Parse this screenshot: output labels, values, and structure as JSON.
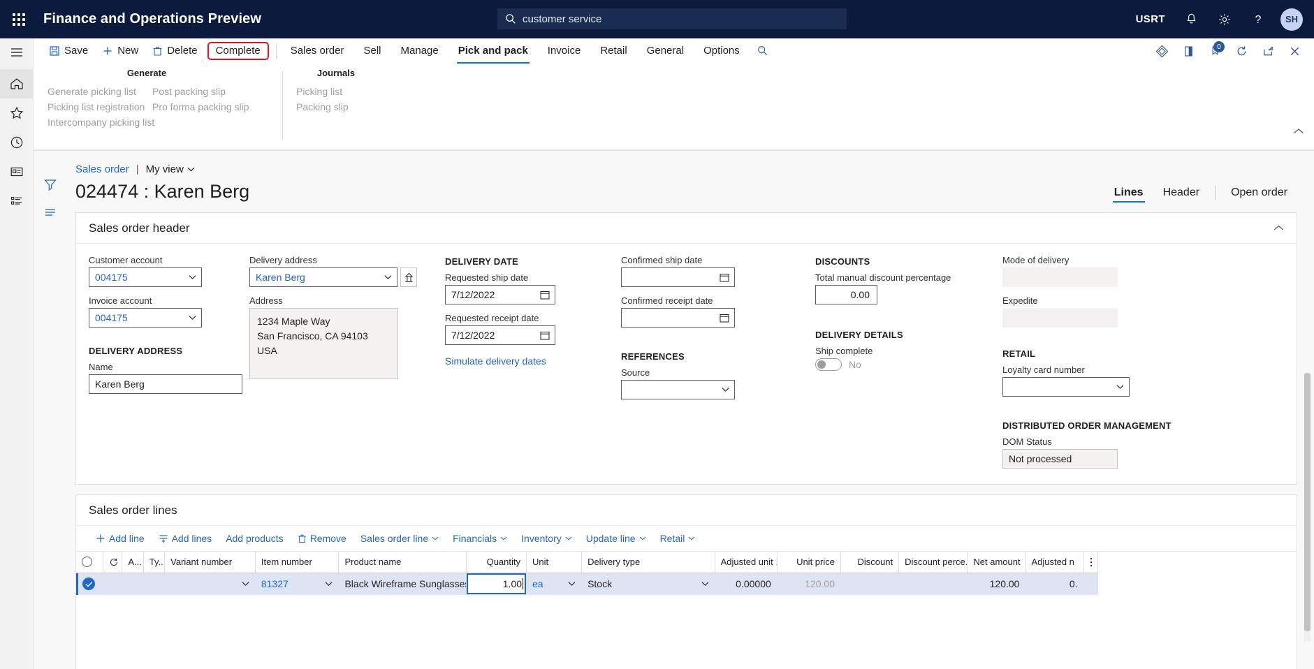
{
  "topbar": {
    "app_title": "Finance and Operations Preview",
    "search_value": "customer service",
    "company": "USRT",
    "avatar_initials": "SH",
    "icons": [
      "waffle-icon",
      "search-icon",
      "notification-bell-icon",
      "settings-gear-icon",
      "help-question-icon"
    ]
  },
  "ribbon": {
    "commands": [
      {
        "label": "Save",
        "icon": "save-icon"
      },
      {
        "label": "New",
        "icon": "plus-icon"
      },
      {
        "label": "Delete",
        "icon": "trash-icon"
      }
    ],
    "complete_label": "Complete",
    "tabs": [
      {
        "label": "Sales order",
        "active": false
      },
      {
        "label": "Sell",
        "active": false
      },
      {
        "label": "Manage",
        "active": false
      },
      {
        "label": "Pick and pack",
        "active": true
      },
      {
        "label": "Invoice",
        "active": false
      },
      {
        "label": "Retail",
        "active": false
      },
      {
        "label": "General",
        "active": false
      },
      {
        "label": "Options",
        "active": false
      }
    ],
    "search_icon": "search-icon",
    "right_icons": [
      "attachments-icon",
      "open-in-new-window-icon",
      "notes-icon",
      "refresh-icon",
      "popout-icon",
      "close-icon"
    ],
    "notes_badge": "0"
  },
  "ribbon_panel": {
    "groups": [
      {
        "title": "Generate",
        "columns": [
          [
            "Generate picking list",
            "Picking list registration",
            "Intercompany picking list"
          ],
          [
            "Post packing slip",
            "Pro forma packing slip"
          ]
        ]
      },
      {
        "title": "Journals",
        "columns": [
          [
            "Picking list",
            "Packing slip"
          ]
        ]
      }
    ]
  },
  "breadcrumb": {
    "root": "Sales order",
    "separator": "|",
    "view": "My view"
  },
  "page": {
    "title": "024474 : Karen Berg",
    "tabs": [
      {
        "label": "Lines",
        "active": true
      },
      {
        "label": "Header",
        "active": false
      },
      {
        "label": "Open order",
        "active": false
      }
    ]
  },
  "header_card": {
    "title": "Sales order header",
    "customer_account": {
      "label": "Customer account",
      "value": "004175"
    },
    "invoice_account": {
      "label": "Invoice account",
      "value": "004175"
    },
    "delivery_address_section": "DELIVERY ADDRESS",
    "name": {
      "label": "Name",
      "value": "Karen Berg"
    },
    "delivery_address": {
      "label": "Delivery address",
      "value": "Karen Berg"
    },
    "address": {
      "label": "Address",
      "value": "1234 Maple Way\nSan Francisco, CA 94103\nUSA"
    },
    "delivery_date_section": "DELIVERY DATE",
    "requested_ship_date": {
      "label": "Requested ship date",
      "value": "7/12/2022"
    },
    "requested_receipt_date": {
      "label": "Requested receipt date",
      "value": "7/12/2022"
    },
    "simulate_link": "Simulate delivery dates",
    "confirmed_ship_date": {
      "label": "Confirmed ship date",
      "value": ""
    },
    "confirmed_receipt_date": {
      "label": "Confirmed receipt date",
      "value": ""
    },
    "references_section": "REFERENCES",
    "source": {
      "label": "Source",
      "value": ""
    },
    "discounts_section": "DISCOUNTS",
    "total_manual_discount": {
      "label": "Total manual discount percentage",
      "value": "0.00"
    },
    "delivery_details_section": "DELIVERY DETAILS",
    "ship_complete": {
      "label": "Ship complete",
      "value": "No"
    },
    "mode_of_delivery": {
      "label": "Mode of delivery",
      "value": ""
    },
    "expedite": {
      "label": "Expedite",
      "value": ""
    },
    "retail_section": "RETAIL",
    "loyalty_card_number": {
      "label": "Loyalty card number",
      "value": ""
    },
    "dom_section": "DISTRIBUTED ORDER MANAGEMENT",
    "dom_status": {
      "label": "DOM Status",
      "value": "Not processed"
    }
  },
  "lines_card": {
    "title": "Sales order lines",
    "toolbar": [
      {
        "label": "Add line",
        "icon": "plus-icon",
        "caret": false
      },
      {
        "label": "Add lines",
        "icon": "add-lines-icon",
        "caret": false
      },
      {
        "label": "Add products",
        "icon": "",
        "caret": false
      },
      {
        "label": "Remove",
        "icon": "trash-icon",
        "caret": false
      },
      {
        "label": "Sales order line",
        "icon": "",
        "caret": true
      },
      {
        "label": "Financials",
        "icon": "",
        "caret": true
      },
      {
        "label": "Inventory",
        "icon": "",
        "caret": true
      },
      {
        "label": "Update line",
        "icon": "",
        "caret": true
      },
      {
        "label": "Retail",
        "icon": "",
        "caret": true
      }
    ],
    "columns": [
      "Variant number",
      "Item number",
      "Product name",
      "Quantity",
      "Unit",
      "Delivery type",
      "Adjusted unit ...",
      "Unit price",
      "Discount",
      "Discount perce...",
      "Net amount",
      "Adjusted n"
    ],
    "mini_columns": [
      "A...",
      "Ty..."
    ],
    "rows": [
      {
        "selected": true,
        "variant_number": "",
        "item_number": "81327",
        "product_name": "Black Wireframe Sunglasses",
        "quantity": "1.00",
        "quantity_editing": true,
        "unit": "ea",
        "delivery_type": "Stock",
        "adjusted_unit_price": "0.00000",
        "unit_price": "120.00",
        "discount": "",
        "discount_percent": "",
        "net_amount": "120.00",
        "adjusted_net": "0."
      }
    ]
  },
  "colors": {
    "brand_navy": "#0b1a3d",
    "accent_blue": "#2266cc",
    "highlight_red": "#e81123",
    "row_selected": "#dde5f5"
  }
}
